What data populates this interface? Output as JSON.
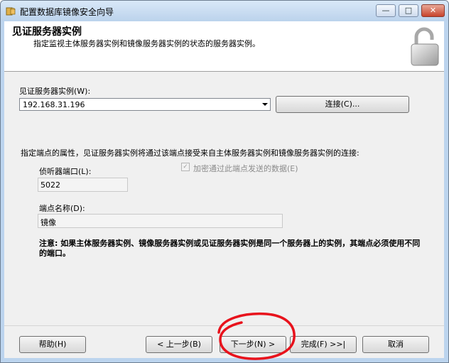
{
  "window": {
    "title": "配置数据库镜像安全向导",
    "controls": {
      "minimize": "—",
      "maximize": "□",
      "close": "✕"
    }
  },
  "header": {
    "title": "见证服务器实例",
    "subtitle": "指定监视主体服务器实例和镜像服务器实例的状态的服务器实例。",
    "icon": "lock-icon"
  },
  "witness": {
    "label": "见证服务器实例(W):",
    "selected_value": "192.168.31.196",
    "connect_button": "连接(C)..."
  },
  "endpoint": {
    "description": "指定端点的属性，见证服务器实例将通过该端点接受来自主体服务器实例和镜像服务器实例的连接:",
    "port_label": "侦听器端口(L):",
    "port_value": "5022",
    "encrypt_label": "加密通过此端点发送的数据(E)",
    "encrypt_checked": true,
    "name_label": "端点名称(D):",
    "name_value": "镜像"
  },
  "note": "注意: 如果主体服务器实例、镜像服务器实例或见证服务器实例是同一个服务器上的实例，其端点必须使用不同的端口。",
  "buttons": {
    "help": "帮助(H)",
    "back": "< 上一步(B)",
    "next": "下一步(N) >",
    "finish": "完成(F) >>|",
    "cancel": "取消"
  },
  "annotation_color": "#e8121c"
}
